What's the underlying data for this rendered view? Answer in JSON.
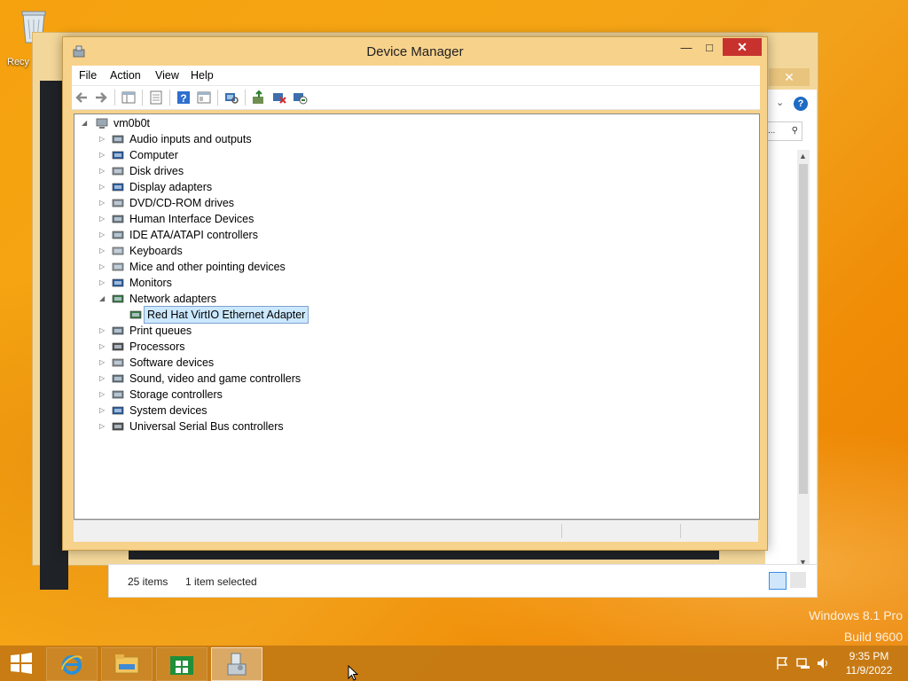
{
  "desktop": {
    "recycle_bin_label": "Recy",
    "watermark_line1": "Windows 8.1 Pro",
    "watermark_line2": "Build 9600"
  },
  "background_window": {
    "status_items": "25 items",
    "status_selected": "1 item selected",
    "search_glyph": "..."
  },
  "device_manager": {
    "title": "Device Manager",
    "menu": [
      "File",
      "Action",
      "View",
      "Help"
    ],
    "toolbar_icons": [
      "back-icon",
      "forward-icon",
      "properties-pane-icon",
      "list-view-icon",
      "help-icon",
      "console-icon",
      "scan-hardware-icon",
      "update-driver-icon",
      "uninstall-device-icon",
      "enable-device-icon"
    ],
    "root": "vm0b0t",
    "categories": [
      {
        "label": "Audio inputs and outputs",
        "icon": "speaker-icon"
      },
      {
        "label": "Computer",
        "icon": "computer-icon"
      },
      {
        "label": "Disk drives",
        "icon": "disk-drive-icon"
      },
      {
        "label": "Display adapters",
        "icon": "display-adapter-icon"
      },
      {
        "label": "DVD/CD-ROM drives",
        "icon": "dvd-drive-icon"
      },
      {
        "label": "Human Interface Devices",
        "icon": "hid-icon"
      },
      {
        "label": "IDE ATA/ATAPI controllers",
        "icon": "ide-controller-icon"
      },
      {
        "label": "Keyboards",
        "icon": "keyboard-icon"
      },
      {
        "label": "Mice and other pointing devices",
        "icon": "mouse-icon"
      },
      {
        "label": "Monitors",
        "icon": "monitor-icon"
      },
      {
        "label": "Network adapters",
        "icon": "network-adapter-icon",
        "expanded": true
      },
      {
        "label": "Print queues",
        "icon": "printer-icon"
      },
      {
        "label": "Processors",
        "icon": "processor-icon"
      },
      {
        "label": "Software devices",
        "icon": "software-device-icon"
      },
      {
        "label": "Sound, video and game controllers",
        "icon": "sound-icon"
      },
      {
        "label": "Storage controllers",
        "icon": "storage-controller-icon"
      },
      {
        "label": "System devices",
        "icon": "system-devices-icon"
      },
      {
        "label": "Universal Serial Bus controllers",
        "icon": "usb-icon"
      }
    ],
    "network_child": "Red Hat VirtIO Ethernet Adapter",
    "minimize_glyph": "—",
    "maximize_glyph": "□",
    "close_glyph": "✕"
  },
  "taskbar": {
    "time": "9:35 PM",
    "date": "11/9/2022",
    "pinned": [
      "internet-explorer-icon",
      "file-explorer-icon",
      "store-icon",
      "device-manager-icon"
    ],
    "active": "device-manager-icon"
  },
  "colors": {
    "accent": "#f5a514",
    "close_red": "#c7322e",
    "selection": "#cce8ff"
  }
}
